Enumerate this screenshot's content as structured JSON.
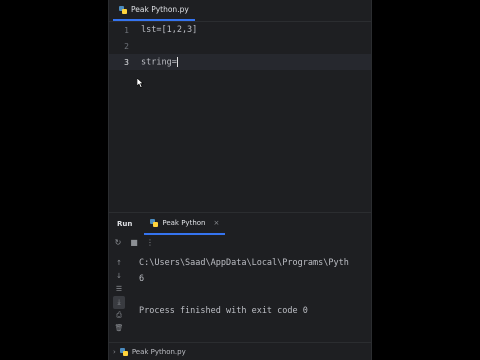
{
  "editor_tab": {
    "file_name": "Peak Python.py",
    "close": "×"
  },
  "editor": {
    "lines": [
      {
        "number": "1",
        "code": "lst=[1,2,3]"
      },
      {
        "number": "2",
        "code": ""
      },
      {
        "number": "3",
        "code": "string="
      }
    ]
  },
  "run_panel": {
    "title": "Run",
    "tab_label": "Peak Python",
    "close": "×",
    "console_lines": [
      "C:\\Users\\Saad\\AppData\\Local\\Programs\\Pyth",
      "6",
      "",
      "Process finished with exit code 0"
    ]
  },
  "statusbar": {
    "chevron": "›",
    "file_name": "Peak Python.py"
  },
  "colors": {
    "background": "#1e1f22",
    "accent": "#3574f0",
    "text": "#bcbec4"
  }
}
